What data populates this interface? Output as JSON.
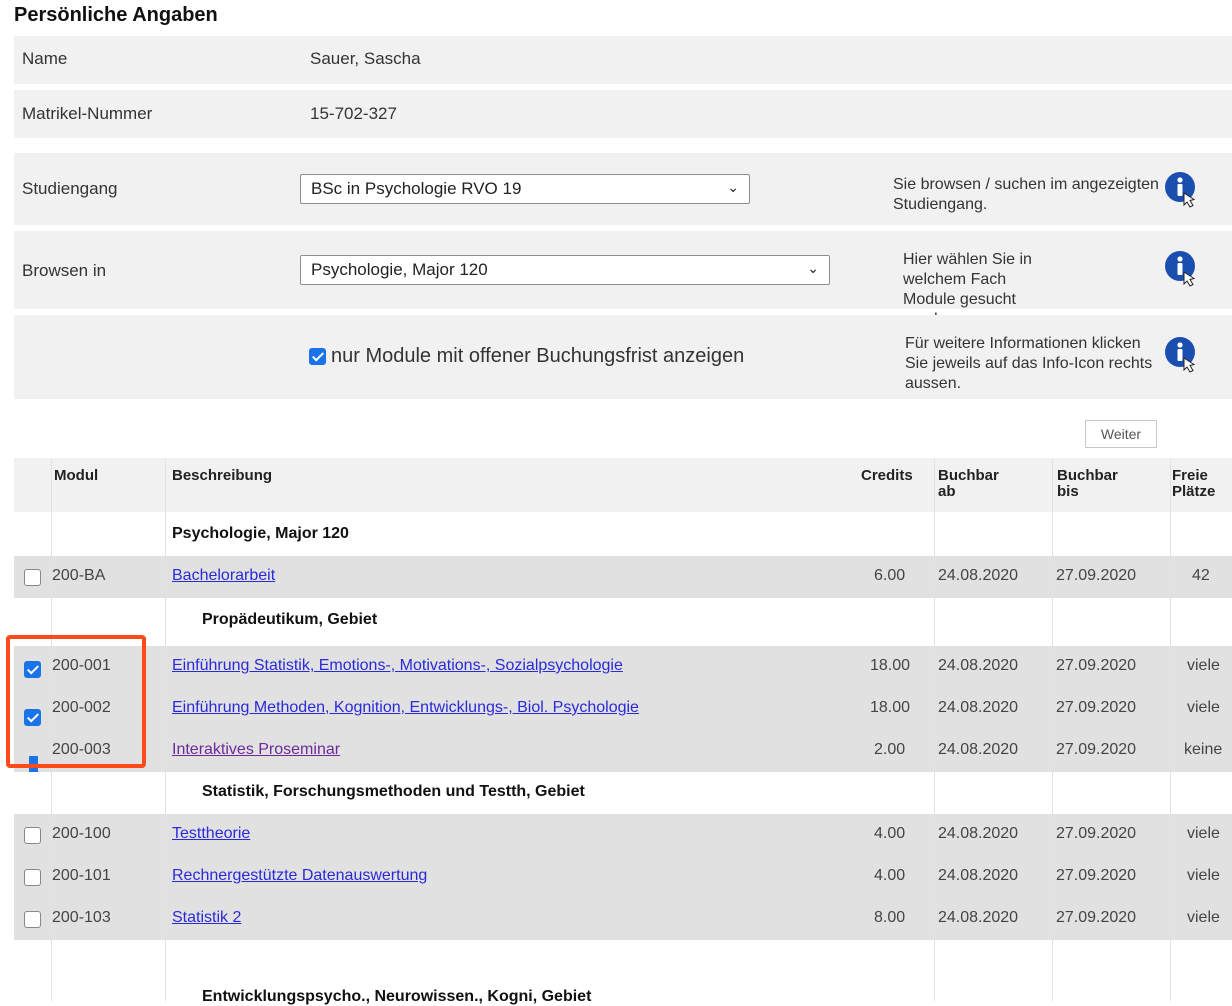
{
  "section_title": "Persönliche Angaben",
  "personal": {
    "name_label": "Name",
    "name_value": "Sauer, Sascha",
    "matrikel_label": "Matrikel-Nummer",
    "matrikel_value": "15-702-327"
  },
  "filters": {
    "studiengang_label": "Studiengang",
    "studiengang_value": "BSc in Psychologie RVO 19",
    "studiengang_info": "Sie browsen / suchen im angezeigten Studiengang.",
    "browsen_label": "Browsen in",
    "browsen_value": "Psychologie, Major 120",
    "browsen_info": "Hier wählen Sie in welchem Fach Module gesucht werden",
    "only_open_label": "nur Module mit offener Buchungsfrist anzeigen",
    "only_open_checked": true,
    "more_info": "Für weitere Informationen klicken Sie jeweils auf das Info-Icon rechts aussen.",
    "weiter_label": "Weiter"
  },
  "table": {
    "headers": {
      "modul": "Modul",
      "beschreibung": "Beschreibung",
      "credits": "Credits",
      "buchbar_ab": "Buchbar ab",
      "buchbar_bis": "Buchbar bis",
      "freie_plaetze": "Freie Plätze"
    },
    "rows": [
      {
        "type": "group",
        "title": "Psychologie, Major 120"
      },
      {
        "type": "module",
        "check": "unchecked",
        "modul": "200-BA",
        "beschreibung": "Bachelorarbeit",
        "credits": "6.00",
        "ab": "24.08.2020",
        "bis": "27.09.2020",
        "frei": "42"
      },
      {
        "type": "group",
        "title": "Propädeutikum, Gebiet"
      },
      {
        "type": "module",
        "check": "checked",
        "modul": "200-001",
        "beschreibung": "Einführung Statistik, Emotions-, Motivations-, Sozialpsychologie",
        "credits": "18.00",
        "ab": "24.08.2020",
        "bis": "27.09.2020",
        "frei": "viele"
      },
      {
        "type": "module",
        "check": "checked",
        "modul": "200-002",
        "beschreibung": "Einführung Methoden, Kognition, Entwicklungs-, Biol. Psychologie",
        "credits": "18.00",
        "ab": "24.08.2020",
        "bis": "27.09.2020",
        "frei": "viele"
      },
      {
        "type": "module",
        "check": "partial",
        "modul": "200-003",
        "beschreibung": "Interaktives Proseminar",
        "credits": "2.00",
        "ab": "24.08.2020",
        "bis": "27.09.2020",
        "frei": "keine"
      },
      {
        "type": "group",
        "title": "Statistik, Forschungsmethoden und Testth, Gebiet"
      },
      {
        "type": "module",
        "check": "unchecked",
        "modul": "200-100",
        "beschreibung": "Testtheorie",
        "credits": "4.00",
        "ab": "24.08.2020",
        "bis": "27.09.2020",
        "frei": "viele"
      },
      {
        "type": "module",
        "check": "unchecked",
        "modul": "200-101",
        "beschreibung": "Rechnergestützte Datenauswertung",
        "credits": "4.00",
        "ab": "24.08.2020",
        "bis": "27.09.2020",
        "frei": "viele"
      },
      {
        "type": "module",
        "check": "unchecked",
        "modul": "200-103",
        "beschreibung": "Statistik 2",
        "credits": "8.00",
        "ab": "24.08.2020",
        "bis": "27.09.2020",
        "frei": "viele"
      },
      {
        "type": "group",
        "title": "Entwicklungspsycho., Neurowissen., Kogni, Gebiet"
      }
    ]
  },
  "colors": {
    "link": "#2a2ad8",
    "checkbox": "#1a73e8",
    "highlight": "#ff4a1a",
    "info_icon": "#1a4fb0"
  }
}
